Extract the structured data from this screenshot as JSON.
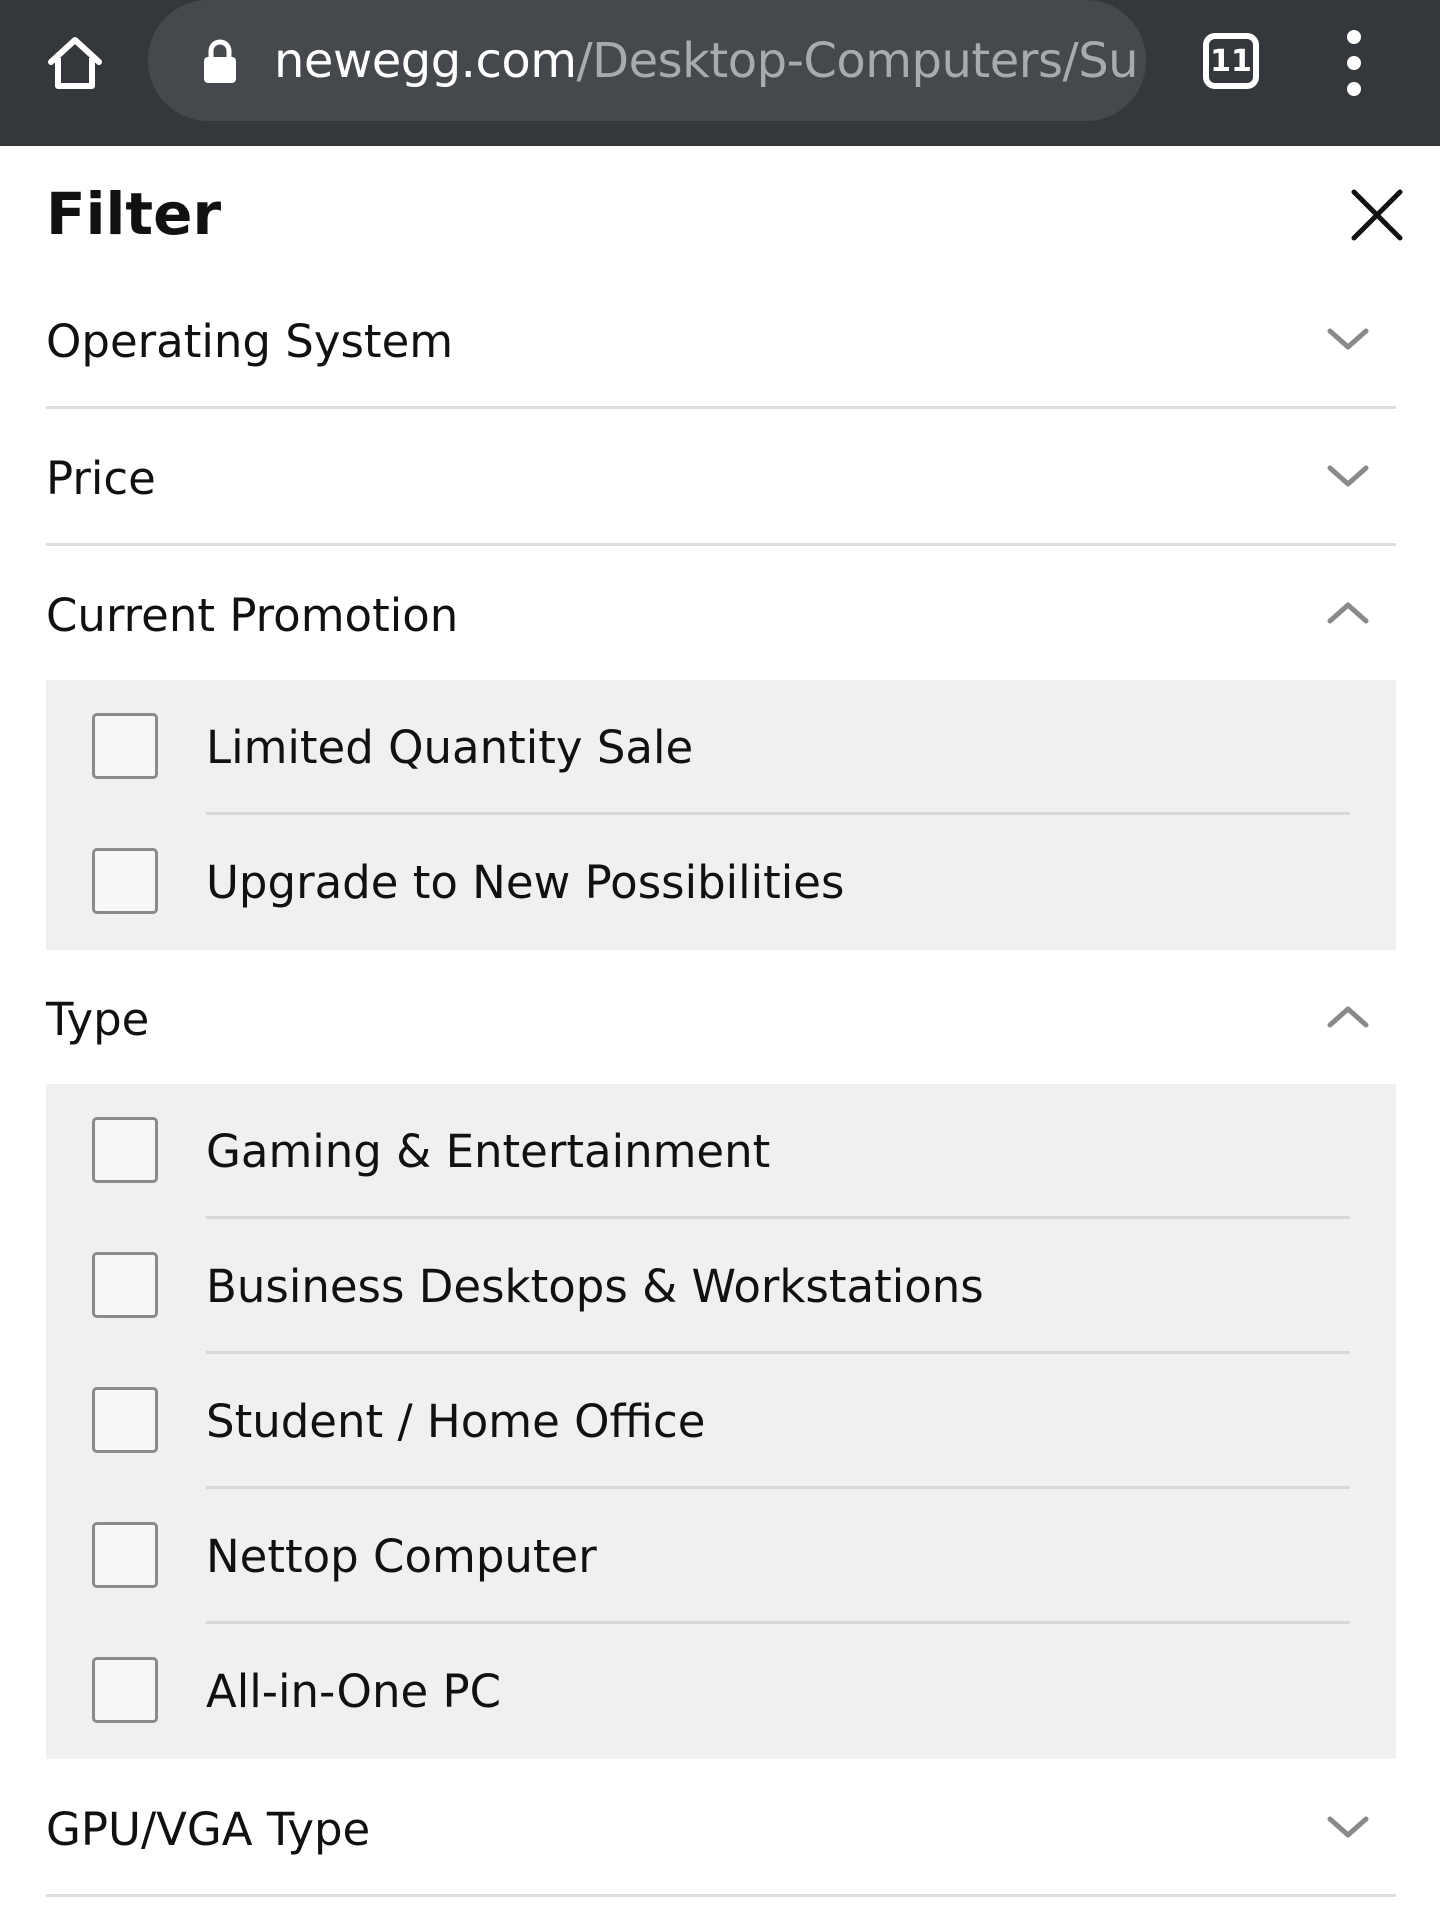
{
  "browser": {
    "url_domain": "newegg.com",
    "url_path": "/Desktop-Computers/Su",
    "tab_count": "11"
  },
  "filter": {
    "title": "Filter",
    "sections": [
      {
        "label": "Operating System",
        "expanded": false
      },
      {
        "label": "Price",
        "expanded": false
      },
      {
        "label": "Current Promotion",
        "expanded": true,
        "options": [
          "Limited Quantity Sale",
          "Upgrade to New Possibilities"
        ]
      },
      {
        "label": "Type",
        "expanded": true,
        "options": [
          "Gaming & Entertainment",
          "Business Desktops & Workstations",
          "Student / Home Office",
          "Nettop Computer",
          "All-in-One PC"
        ]
      },
      {
        "label": "GPU/VGA Type",
        "expanded": false
      }
    ]
  }
}
